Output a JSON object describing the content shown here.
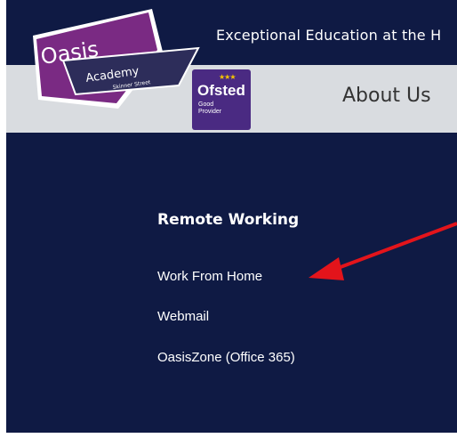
{
  "header": {
    "tagline": "Exceptional Education at the H",
    "logo": {
      "name": "Oasis",
      "line2": "Academy",
      "line3": "Skinner Street"
    },
    "ofsted": {
      "title": "Ofsted",
      "subtitle": "Good Provider"
    }
  },
  "nav": {
    "items": [
      "About Us"
    ]
  },
  "main": {
    "section_title": "Remote Working",
    "links": [
      "Work From Home",
      "Webmail",
      "OasisZone (Office 365)"
    ]
  },
  "colors": {
    "navy": "#0f1a44",
    "nav_bg": "#d9dce0",
    "logo_purple": "#7a2a83",
    "ofsted_purple": "#4a2a82",
    "annotation_arrow": "#e3141b"
  },
  "icons": [
    "oasis-academy-logo",
    "ofsted-badge",
    "annotation-arrow"
  ]
}
